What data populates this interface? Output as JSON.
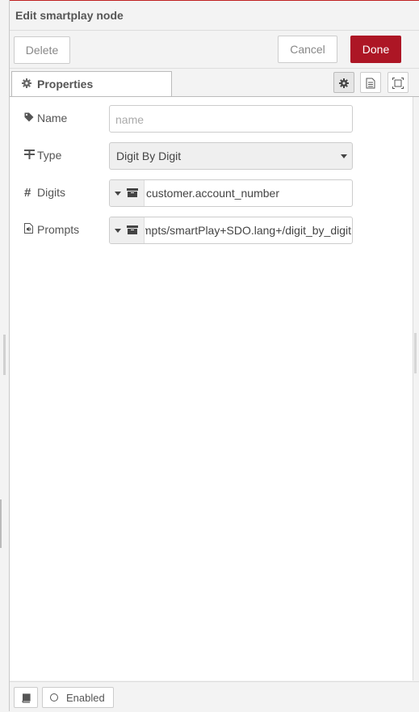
{
  "tray": {
    "title": "Edit smartplay node"
  },
  "toolbar": {
    "delete_label": "Delete",
    "cancel_label": "Cancel",
    "done_label": "Done",
    "done_color": "#ad1625"
  },
  "tabs": [
    {
      "label": "Properties",
      "icon": "gear-icon"
    }
  ],
  "tab_tools": [
    {
      "icon": "gear-icon"
    },
    {
      "icon": "document-icon"
    },
    {
      "icon": "frame-icon"
    }
  ],
  "form": {
    "name": {
      "label": "Name",
      "icon": "tag-icon",
      "value": "",
      "placeholder": "name"
    },
    "type": {
      "label": "Type",
      "icon": "filter-icon",
      "selected": "Digit By Digit"
    },
    "digits": {
      "label": "Digits",
      "icon": "hash-icon",
      "value_type_icon": "archive-icon",
      "value": "customer.account_number"
    },
    "prompts": {
      "label": "Prompts",
      "icon": "audio-file-icon",
      "value_type_icon": "archive-icon",
      "value": "mpts/smartPlay+SDO.lang+/digit_by_digit"
    }
  },
  "footer": {
    "book_icon": "book-icon",
    "enabled_label": "Enabled"
  }
}
